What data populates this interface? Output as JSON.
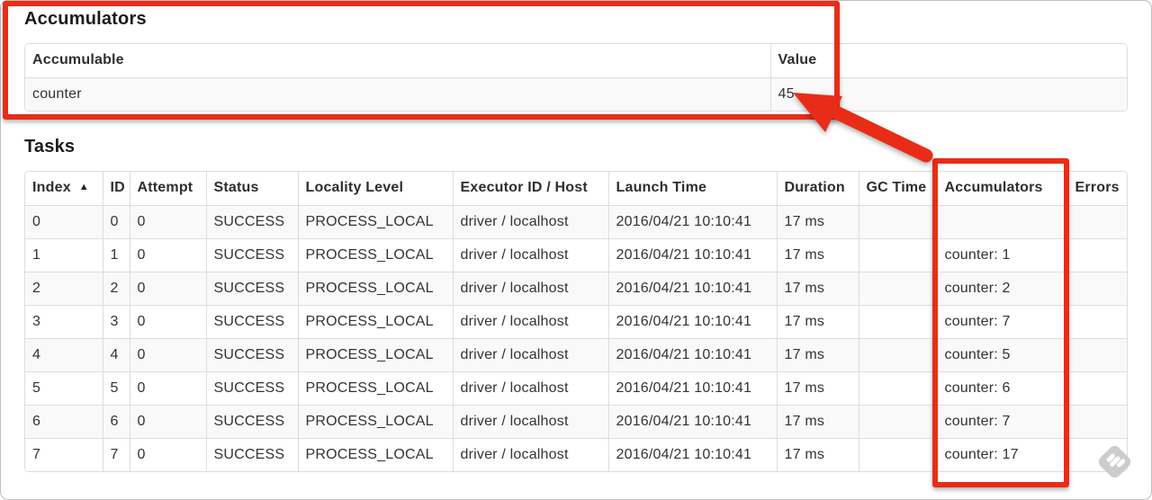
{
  "colors": {
    "annotation_red": "#e92c17",
    "table_border": "#dddddd",
    "row_stripe": "#f9f9f9",
    "text": "#333333",
    "watermark_gray": "#c9c9c9"
  },
  "icons": {
    "sort_ascending": "▲",
    "watermark": "skitch-pen-diamond"
  },
  "accumulators_section": {
    "title": "Accumulators",
    "table": {
      "columns": [
        {
          "key": "accumulable",
          "label": "Accumulable"
        },
        {
          "key": "value",
          "label": "Value"
        }
      ],
      "rows": [
        {
          "accumulable": "counter",
          "value": "45"
        }
      ]
    }
  },
  "tasks_section": {
    "title": "Tasks",
    "sort": {
      "column": "Index",
      "direction": "ascending"
    },
    "table": {
      "columns": [
        {
          "key": "index",
          "label": "Index",
          "sorted": true
        },
        {
          "key": "id",
          "label": "ID"
        },
        {
          "key": "attempt",
          "label": "Attempt"
        },
        {
          "key": "status",
          "label": "Status"
        },
        {
          "key": "locality_level",
          "label": "Locality Level"
        },
        {
          "key": "executor_id_host",
          "label": "Executor ID / Host"
        },
        {
          "key": "launch_time",
          "label": "Launch Time"
        },
        {
          "key": "duration",
          "label": "Duration"
        },
        {
          "key": "gc_time",
          "label": "GC Time"
        },
        {
          "key": "accumulators",
          "label": "Accumulators"
        },
        {
          "key": "errors",
          "label": "Errors"
        }
      ],
      "rows": [
        {
          "index": "0",
          "id": "0",
          "attempt": "0",
          "status": "SUCCESS",
          "locality_level": "PROCESS_LOCAL",
          "executor_id_host": "driver / localhost",
          "launch_time": "2016/04/21 10:10:41",
          "duration": "17 ms",
          "gc_time": "",
          "accumulators": "",
          "errors": ""
        },
        {
          "index": "1",
          "id": "1",
          "attempt": "0",
          "status": "SUCCESS",
          "locality_level": "PROCESS_LOCAL",
          "executor_id_host": "driver / localhost",
          "launch_time": "2016/04/21 10:10:41",
          "duration": "17 ms",
          "gc_time": "",
          "accumulators": "counter: 1",
          "errors": ""
        },
        {
          "index": "2",
          "id": "2",
          "attempt": "0",
          "status": "SUCCESS",
          "locality_level": "PROCESS_LOCAL",
          "executor_id_host": "driver / localhost",
          "launch_time": "2016/04/21 10:10:41",
          "duration": "17 ms",
          "gc_time": "",
          "accumulators": "counter: 2",
          "errors": ""
        },
        {
          "index": "3",
          "id": "3",
          "attempt": "0",
          "status": "SUCCESS",
          "locality_level": "PROCESS_LOCAL",
          "executor_id_host": "driver / localhost",
          "launch_time": "2016/04/21 10:10:41",
          "duration": "17 ms",
          "gc_time": "",
          "accumulators": "counter: 7",
          "errors": ""
        },
        {
          "index": "4",
          "id": "4",
          "attempt": "0",
          "status": "SUCCESS",
          "locality_level": "PROCESS_LOCAL",
          "executor_id_host": "driver / localhost",
          "launch_time": "2016/04/21 10:10:41",
          "duration": "17 ms",
          "gc_time": "",
          "accumulators": "counter: 5",
          "errors": ""
        },
        {
          "index": "5",
          "id": "5",
          "attempt": "0",
          "status": "SUCCESS",
          "locality_level": "PROCESS_LOCAL",
          "executor_id_host": "driver / localhost",
          "launch_time": "2016/04/21 10:10:41",
          "duration": "17 ms",
          "gc_time": "",
          "accumulators": "counter: 6",
          "errors": ""
        },
        {
          "index": "6",
          "id": "6",
          "attempt": "0",
          "status": "SUCCESS",
          "locality_level": "PROCESS_LOCAL",
          "executor_id_host": "driver / localhost",
          "launch_time": "2016/04/21 10:10:41",
          "duration": "17 ms",
          "gc_time": "",
          "accumulators": "counter: 7",
          "errors": ""
        },
        {
          "index": "7",
          "id": "7",
          "attempt": "0",
          "status": "SUCCESS",
          "locality_level": "PROCESS_LOCAL",
          "executor_id_host": "driver / localhost",
          "launch_time": "2016/04/21 10:10:41",
          "duration": "17 ms",
          "gc_time": "",
          "accumulators": "counter: 17",
          "errors": ""
        }
      ]
    }
  }
}
